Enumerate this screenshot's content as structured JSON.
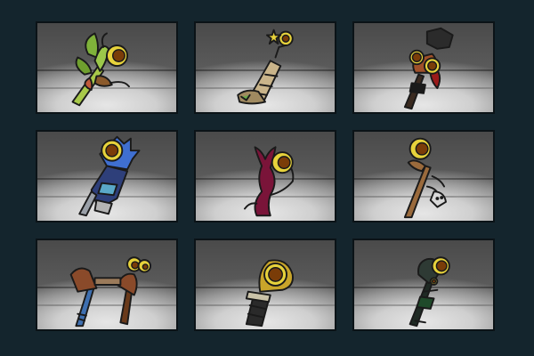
{
  "title": "",
  "grid": {
    "rows": 3,
    "columns": 3
  },
  "items": [
    {
      "id": "staff-1",
      "icon": "green-tentacle-eye-staff-icon",
      "accent": "#8fbf2e"
    },
    {
      "id": "staff-2",
      "icon": "stone-tower-eye-staff-icon",
      "accent": "#c9b48a"
    },
    {
      "id": "staff-3",
      "icon": "dark-twin-eye-staff-icon",
      "accent": "#2b2b2b"
    },
    {
      "id": "staff-4",
      "icon": "blue-crystal-eye-staff-icon",
      "accent": "#3f6fd1"
    },
    {
      "id": "staff-5",
      "icon": "crimson-tentacle-eye-staff-icon",
      "accent": "#7a1439"
    },
    {
      "id": "staff-6",
      "icon": "wooden-skull-eye-staff-icon",
      "accent": "#9a6a3c"
    },
    {
      "id": "staff-7",
      "icon": "brown-twin-eye-totem-staff-icon",
      "accent": "#8a4a2a"
    },
    {
      "id": "staff-8",
      "icon": "pillar-eye-staff-icon",
      "accent": "#c9a52a"
    },
    {
      "id": "staff-9",
      "icon": "dark-green-eye-staff-icon",
      "accent": "#1f4a2a"
    }
  ],
  "colors": {
    "background": "#14252d",
    "eye": "#e7d23b",
    "pupil": "#7a3c08"
  }
}
